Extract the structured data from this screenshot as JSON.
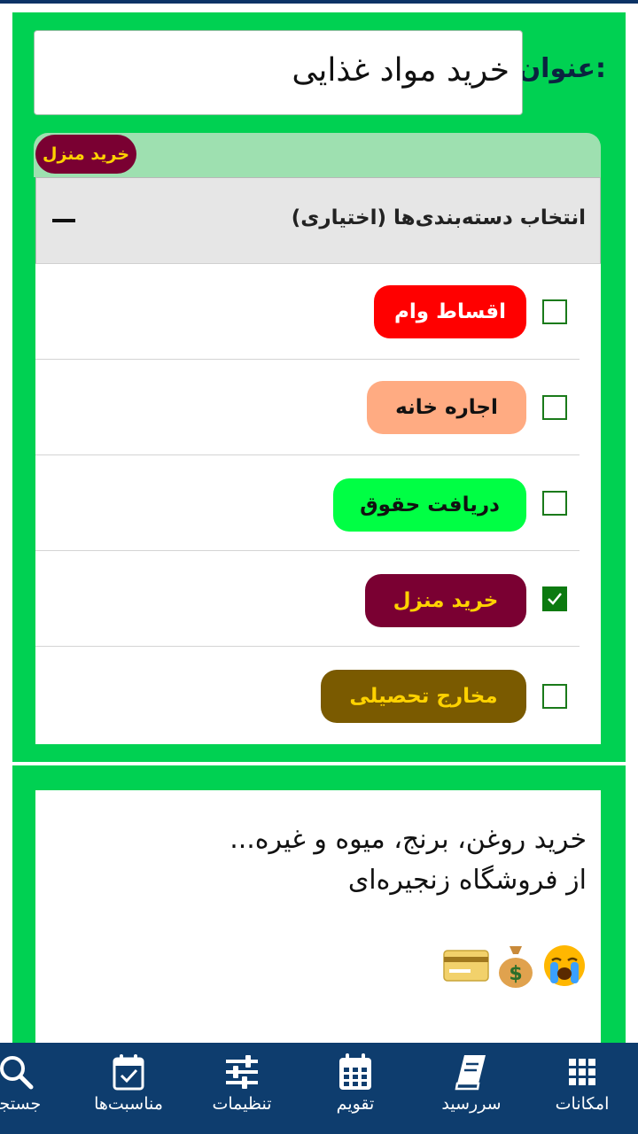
{
  "title_field": {
    "label": "عنوان:",
    "value": "خرید مواد غذایی"
  },
  "selected_tag": {
    "label": "خرید منزل",
    "bg": "#7a0032",
    "fg": "#ffd200"
  },
  "categories": {
    "header": "انتخاب دسته‌بندی‌ها (اختیاری)",
    "collapse_icon": "minus-icon",
    "items": [
      {
        "label": "اقساط وام",
        "bg": "#ff0000",
        "fg": "#ffffff",
        "checked": false
      },
      {
        "label": "اجاره خانه",
        "bg": "#ffab82",
        "fg": "#111111",
        "checked": false
      },
      {
        "label": "دریافت حقوق",
        "bg": "#00ff44",
        "fg": "#111111",
        "checked": false
      },
      {
        "label": "خرید منزل",
        "bg": "#7a0032",
        "fg": "#ffd200",
        "checked": true
      },
      {
        "label": "مخارج تحصیلی",
        "bg": "#7a5a00",
        "fg": "#ffd200",
        "checked": false
      }
    ]
  },
  "note": {
    "line1": "خرید روغن، برنج، میوه و غیره...",
    "line2": "از فروشگاه زنجیره‌ای",
    "emojis": [
      "crying-face-icon",
      "money-bag-icon",
      "credit-card-icon"
    ]
  },
  "bottom_nav": {
    "items": [
      {
        "label": "امکانات",
        "icon": "grid-icon"
      },
      {
        "label": "سررسید",
        "icon": "book-icon"
      },
      {
        "label": "تقویم",
        "icon": "calendar-icon"
      },
      {
        "label": "تنظیمات",
        "icon": "sliders-icon"
      },
      {
        "label": "مناسبت‌ها",
        "icon": "calendar-check-icon"
      },
      {
        "label": "جستجو",
        "icon": "search-icon"
      }
    ]
  },
  "colors": {
    "accent_green": "#00d152",
    "nav_bg": "#0e3d6e"
  }
}
